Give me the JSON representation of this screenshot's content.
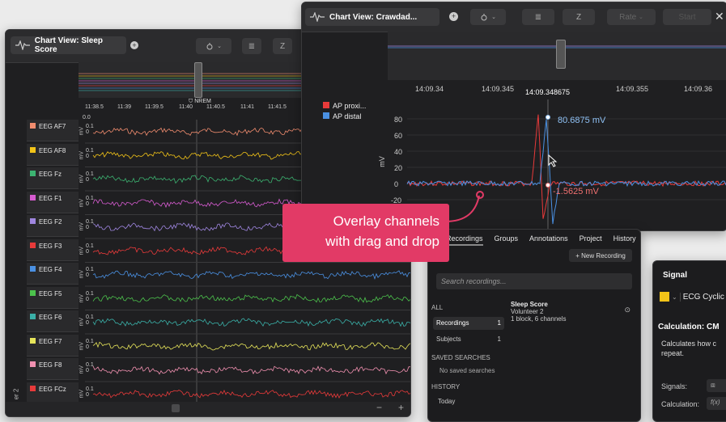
{
  "win_left": {
    "title": "Chart View: Sleep Score",
    "marker_label": "NREM",
    "time_ticks": [
      "11:38.5",
      "11:39",
      "11:39.5",
      "11:40",
      "11:40.5",
      "11:41",
      "11:41.5"
    ],
    "unit": "mV",
    "val_top": "0.1",
    "val_zero": "0",
    "val_top_zero": "0.0",
    "side_label": "er 2",
    "minus": "−",
    "plus": "+",
    "channels": [
      {
        "name": "EEG AF7",
        "color": "#f08c6e"
      },
      {
        "name": "EEG AF8",
        "color": "#f2c318"
      },
      {
        "name": "EEG Fz",
        "color": "#3cb371"
      },
      {
        "name": "EEG F1",
        "color": "#d65bd0"
      },
      {
        "name": "EEG F2",
        "color": "#9f86e0"
      },
      {
        "name": "EEG F3",
        "color": "#e83a3a"
      },
      {
        "name": "EEG F4",
        "color": "#4a90e2"
      },
      {
        "name": "EEG F5",
        "color": "#4cc24c"
      },
      {
        "name": "EEG F6",
        "color": "#3ab0a8"
      },
      {
        "name": "EEG F7",
        "color": "#e6e45a"
      },
      {
        "name": "EEG F8",
        "color": "#f090b0"
      },
      {
        "name": "EEG FCz",
        "color": "#e83a3a"
      }
    ]
  },
  "win_right": {
    "title": "Chart View: Crawdad...",
    "rate": "Rate",
    "start": "Start",
    "close": "✕",
    "time_ticks": [
      "14:09.34",
      "14:09.345",
      "14:09.348675",
      "14:09.355",
      "14:09.36"
    ],
    "legend": [
      {
        "name": "AP proxi...",
        "color": "#e83a3a"
      },
      {
        "name": "AP distal",
        "color": "#4a90e2"
      }
    ],
    "y_ticks": [
      "80",
      "60",
      "40",
      "20",
      "0",
      "-20"
    ],
    "unit": "mV",
    "readout_blue": "80.6875 mV",
    "readout_red": "-1.5625 mV"
  },
  "callout": {
    "line1": "Overlay channels",
    "line2": "with drag and drop"
  },
  "win_rec": {
    "tabs": [
      "Recordings",
      "Groups",
      "Annotations",
      "Project",
      "History"
    ],
    "new_button": "+ New Recording",
    "search_placeholder": "Search recordings...",
    "all_label": "ALL",
    "recordings_label": "Recordings",
    "recordings_count": "1",
    "subjects_label": "Subjects",
    "subjects_count": "1",
    "saved_label": "SAVED SEARCHES",
    "no_saved": "No saved searches",
    "history_label": "HISTORY",
    "today_label": "Today",
    "rec_title": "Sleep Score",
    "rec_sub": "Volunteer 2",
    "rec_meta": "1 block, 6 channels"
  },
  "win_signal": {
    "tab": "Signal",
    "channel": "ECG Cyclic",
    "calc_title": "Calculation: CM",
    "desc": "Calculates how c repeat.",
    "signals_label": "Signals:",
    "calc_label": "Calculation:",
    "swatch": "#f2c318"
  }
}
